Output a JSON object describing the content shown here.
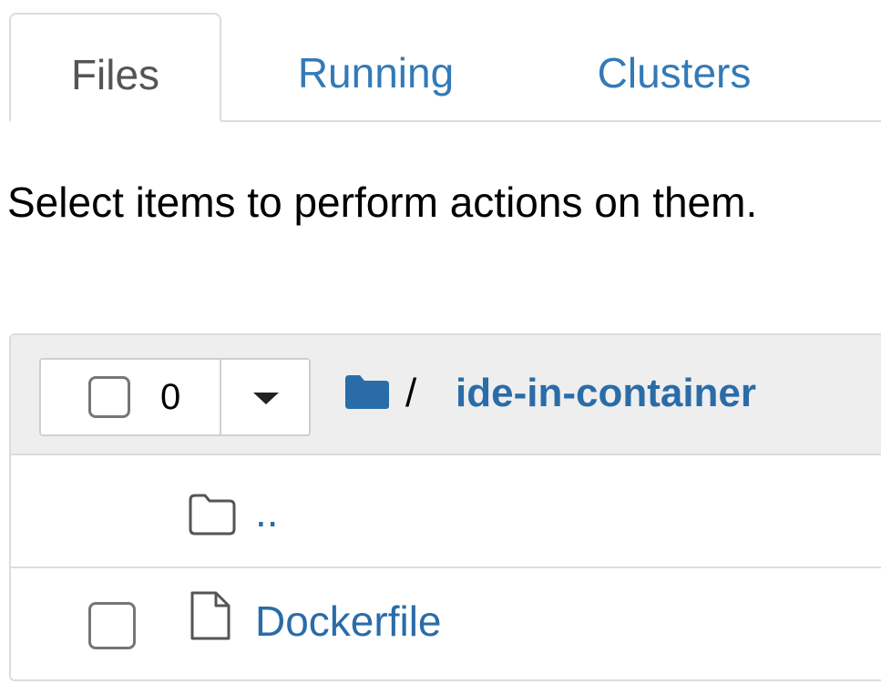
{
  "tabs": [
    {
      "label": "Files",
      "active": true
    },
    {
      "label": "Running",
      "active": false
    },
    {
      "label": "Clusters",
      "active": false
    }
  ],
  "help_text": "Select items to perform actions on them.",
  "toolbar": {
    "selected_count": "0",
    "dropdown_icon": "caret-down-icon"
  },
  "breadcrumb": {
    "root_icon": "folder-icon",
    "separator": "/",
    "current": "ide-in-container"
  },
  "items": [
    {
      "name": "..",
      "type": "parent-folder",
      "icon": "folder-open-icon",
      "selectable": false
    },
    {
      "name": "Dockerfile",
      "type": "file",
      "icon": "file-icon",
      "selectable": true
    }
  ],
  "colors": {
    "link": "#337ab7",
    "active_tab_text": "#555555",
    "header_bg": "#eeeeee",
    "border": "#dcdcdc"
  }
}
